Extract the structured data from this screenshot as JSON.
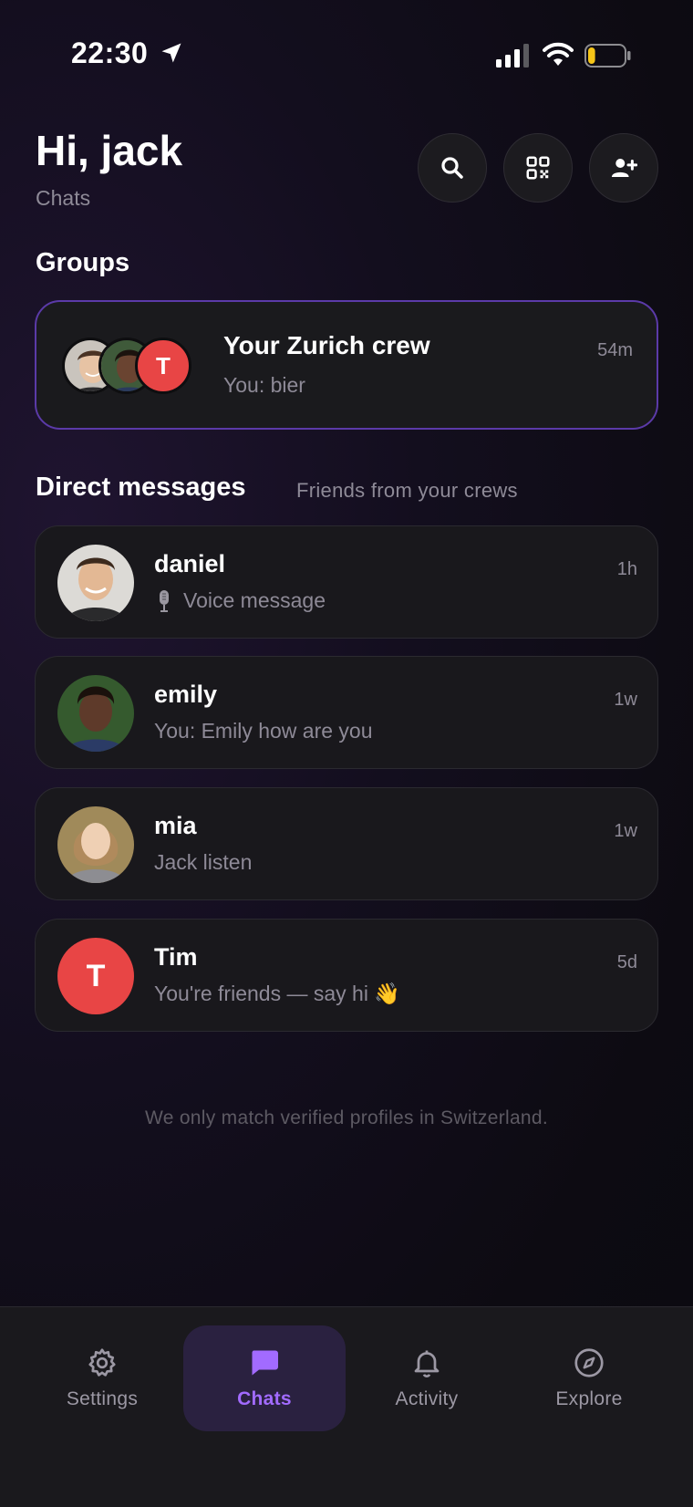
{
  "status_bar": {
    "time": "22:30",
    "battery_level": 0.2,
    "battery_color": "#f5c518"
  },
  "header": {
    "greeting": "Hi, jack",
    "subtitle": "Chats"
  },
  "header_buttons": [
    "search-icon",
    "qr-code-icon",
    "add-user-icon"
  ],
  "groups": {
    "title": "Groups",
    "items": [
      {
        "name": "Your Zurich crew",
        "last_message": "You: bier",
        "time": "54m",
        "avatar_initial": "T"
      }
    ]
  },
  "direct_messages": {
    "title": "Direct messages",
    "subtitle": "Friends from your crews",
    "items": [
      {
        "name": "daniel",
        "last_message": "Voice message",
        "time": "1h",
        "icon": "microphone-icon"
      },
      {
        "name": "emily",
        "last_message": "You: Emily how are you",
        "time": "1w"
      },
      {
        "name": "mia",
        "last_message": "Jack listen",
        "time": "1w"
      },
      {
        "name": "Tim",
        "last_message": "You're friends — say hi 👋",
        "time": "5d",
        "avatar_initial": "T"
      }
    ]
  },
  "footer_note": "We only match verified profiles in Switzerland.",
  "tabs": [
    {
      "label": "Settings",
      "icon": "gear-icon",
      "active": false
    },
    {
      "label": "Chats",
      "icon": "chat-bubble-icon",
      "active": true
    },
    {
      "label": "Activity",
      "icon": "bell-icon",
      "active": false
    },
    {
      "label": "Explore",
      "icon": "compass-icon",
      "active": false
    }
  ],
  "colors": {
    "accent": "#a26bff",
    "group_border": "#5b3aa8",
    "avatar_red": "#e84545"
  }
}
